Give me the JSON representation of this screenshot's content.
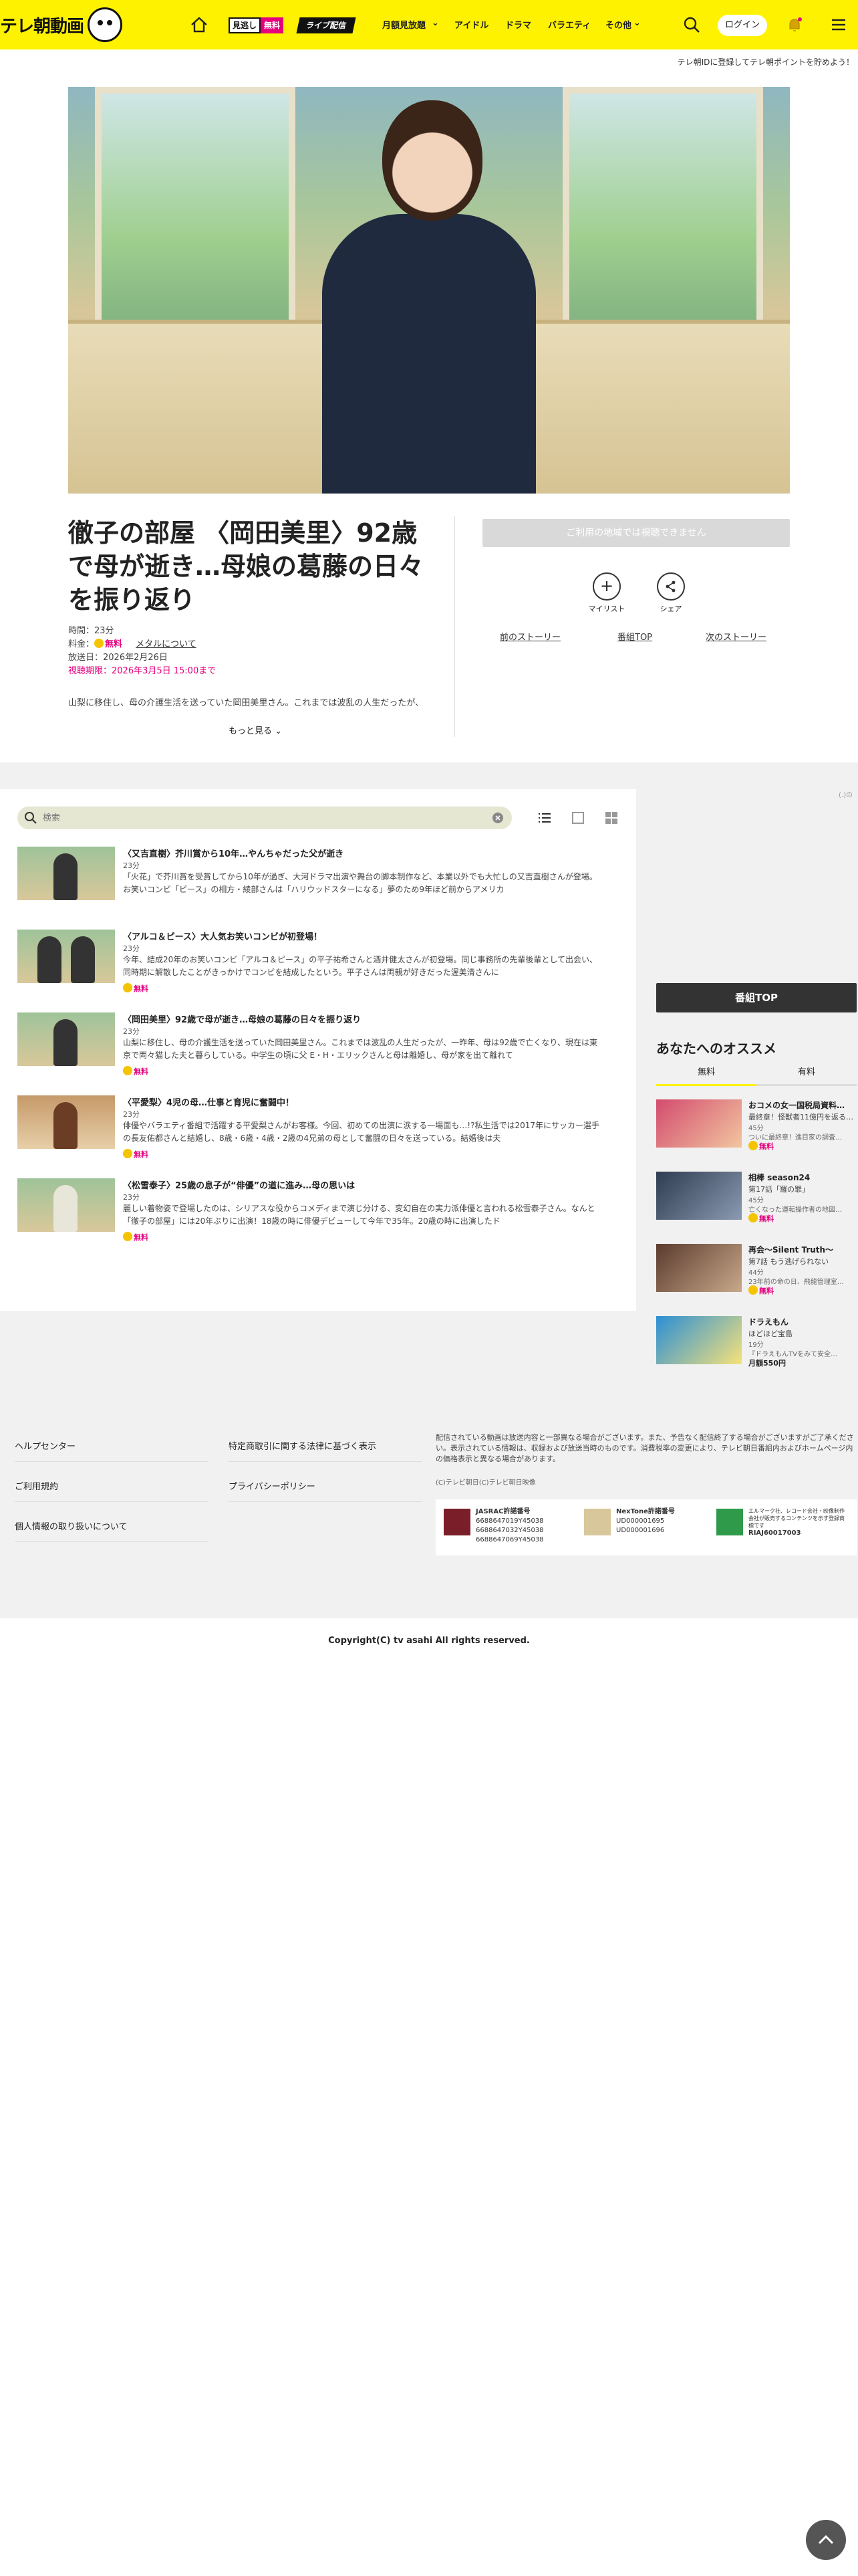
{
  "header": {
    "logo_text": "テレ朝動画",
    "badge_free_a": "見逃し",
    "badge_free_b": "無料",
    "badge_live": "ライブ配信",
    "nav": [
      "月額見放題",
      "アイドル",
      "ドラマ",
      "バラエティ",
      "その他"
    ],
    "login": "ログイン",
    "accent_color": "#fff200"
  },
  "promo": "テレ朝IDに登録してテレ朝ポイントを貯めよう！",
  "episode": {
    "title": "徹子の部屋 〈岡田美里〉92歳で母が逝き…母娘の葛藤の日々を振り返り",
    "duration": "時間：23分",
    "price_label": "料金：",
    "price": "無料",
    "meta_link": "メタルについて",
    "aired": "放送日：2026年2月26日",
    "expiry": "視聴期限：2026年3月5日 15:00まで",
    "desc": "山梨に移住し、母の介護生活を送っていた岡田美里さん。これまでは波乱の人生だったが、",
    "more": "もっと見る"
  },
  "actions": {
    "not_playable": "ご利用の地域では視聴できません",
    "mylist": "マイリスト",
    "share": "シェア",
    "prev": "前のストーリー",
    "top": "番組TOP",
    "next": "次のストーリー"
  },
  "search": {
    "placeholder": "検索"
  },
  "ad_tag": "(.)の",
  "episodes": [
    {
      "title": "〈又吉直樹〉芥川賞から10年…やんちゃだった父が逝き",
      "duration": "23分",
      "desc": "「火花」で芥川賞を受賞してから10年が過ぎ、大河ドラマ出演や舞台の脚本制作など、本業以外でも大忙しの又吉直樹さんが登場。 お笑いコンビ「ピース」の相方・綾部さんは「ハリウッドスターになる」夢のため9年ほど前からアメリカ",
      "free": "無料"
    },
    {
      "title": "〈アルコ＆ピース〉大人気お笑いコンビが初登場！",
      "duration": "23分",
      "desc": "今年、結成20年のお笑いコンビ「アルコ＆ピース」の平子祐希さんと酒井健太さんが初登場。同じ事務所の先輩後輩として出会い、同時期に解散したことがきっかけでコンビを結成したという。平子さんは両親が好きだった渥美清さんに",
      "free": "無料"
    },
    {
      "title": "〈岡田美里〉92歳で母が逝き…母娘の葛藤の日々を振り返り",
      "duration": "23分",
      "desc": "山梨に移住し、母の介護生活を送っていた岡田美里さん。これまでは波乱の人生だったが、一昨年、母は92歳で亡くなり、現在は東京で両々猫した夫と暮らしている。中学生の頃に父 E・H・エリックさんと母は離婚し、母が家を出て離れて",
      "free": "無料"
    },
    {
      "title": "〈平愛梨〉4児の母…仕事と育児に奮闘中！",
      "duration": "23分",
      "desc": "俳優やバラエティ番組で活躍する平愛梨さんがお客様。今回、初めての出演に涙する一場面も…!?私生活では2017年にサッカー選手の長友佑都さんと結婚し、8歳・6歳・4歳・2歳の4兄弟の母として奮闘の日々を送っている。結婚後は夫",
      "free": "無料"
    },
    {
      "title": "〈松雪泰子〉25歳の息子が“俳優”の道に進み…母の思いは",
      "duration": "23分",
      "desc": "麗しい着物姿で登場したのは、シリアスな役からコメディまで演じ分ける、変幻自在の実力派俳優と言われる松雪泰子さん。なんと「徹子の部屋」には20年ぶりに出演！18歳の時に俳優デビューして今年で35年。20歳の時に出演したド",
      "free": "無料"
    }
  ],
  "sidebar": {
    "top_button": "番組TOP",
    "heading": "あなたへのオススメ",
    "tabs": [
      "無料",
      "有料"
    ],
    "items": [
      {
        "title": "おコメの女一国税局資料…",
        "sub": "最終章！怪獣者11億円を返る…",
        "dur": "45分",
        "desc": "ついに最終章！進目家の調査…",
        "free": "無料"
      },
      {
        "title": "相棒 season24",
        "sub": "第17話「羅の罪」",
        "dur": "45分",
        "desc": "亡くなった運転操作者の地図…",
        "free": "無料"
      },
      {
        "title": "再会～Silent Truth～",
        "sub": "第7話 もう逃げられない",
        "dur": "44分",
        "desc": "23年前の命の日、飛龍管理室…",
        "free": "無料"
      },
      {
        "title": "ドラえもん",
        "sub": "ほどほど宝島",
        "dur": "19分",
        "desc": "『ドラえもんTVをみて安全…",
        "price": "月額550円"
      }
    ]
  },
  "footer": {
    "links": [
      "ヘルプセンター",
      "ご利用規約",
      "個人情報の取り扱いについて",
      "特定商取引に関する法律に基づく表示",
      "プライバシーポリシー"
    ],
    "note": "配信されている動画は放送内容と一部異なる場合がございます。また、予告なく配信終了する場合がございますがご了承ください。表示されている情報は、収録および放送当時のものです。消費税率の変更により、テレビ朝日番組内およびホームページ内の価格表示と異なる場合があります。",
    "copy_tv": "(C)テレビ朝日(C)テレビ朝日映像",
    "jasrac_title": "JASRAC許諾番号",
    "jasrac_nums": [
      "6688647019Y45038",
      "6688647032Y45038",
      "6688647069Y45038"
    ],
    "nextone_title": "NexTone許諾番号",
    "nextone_nums": [
      "UD000001695",
      "UD000001696"
    ],
    "riaj_text": "エルマーク社、レコード会社・映像制作会社が販売するコンテンツを示す登録商標です",
    "riaj_num": "RIAJ60017003",
    "copyright": "Copyright(C) tv asahi All rights reserved."
  }
}
